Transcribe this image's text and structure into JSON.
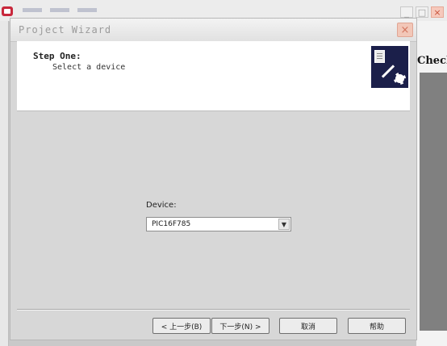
{
  "wizard": {
    "title": "Project Wizard",
    "step_title": "Step One:",
    "step_subtitle": "Select a device",
    "device_label": "Device:",
    "device_value": "PIC16F785"
  },
  "buttons": {
    "back": "< 上一步(B)",
    "next": "下一步(N) >",
    "cancel": "取消",
    "help": "帮助"
  },
  "background": {
    "right_pane_text": "Check",
    "title_buttons": {
      "minimize": "_",
      "maximize": "□",
      "close": "×"
    }
  },
  "icons": {
    "dialog_close": "×",
    "dropdown": "▼"
  }
}
